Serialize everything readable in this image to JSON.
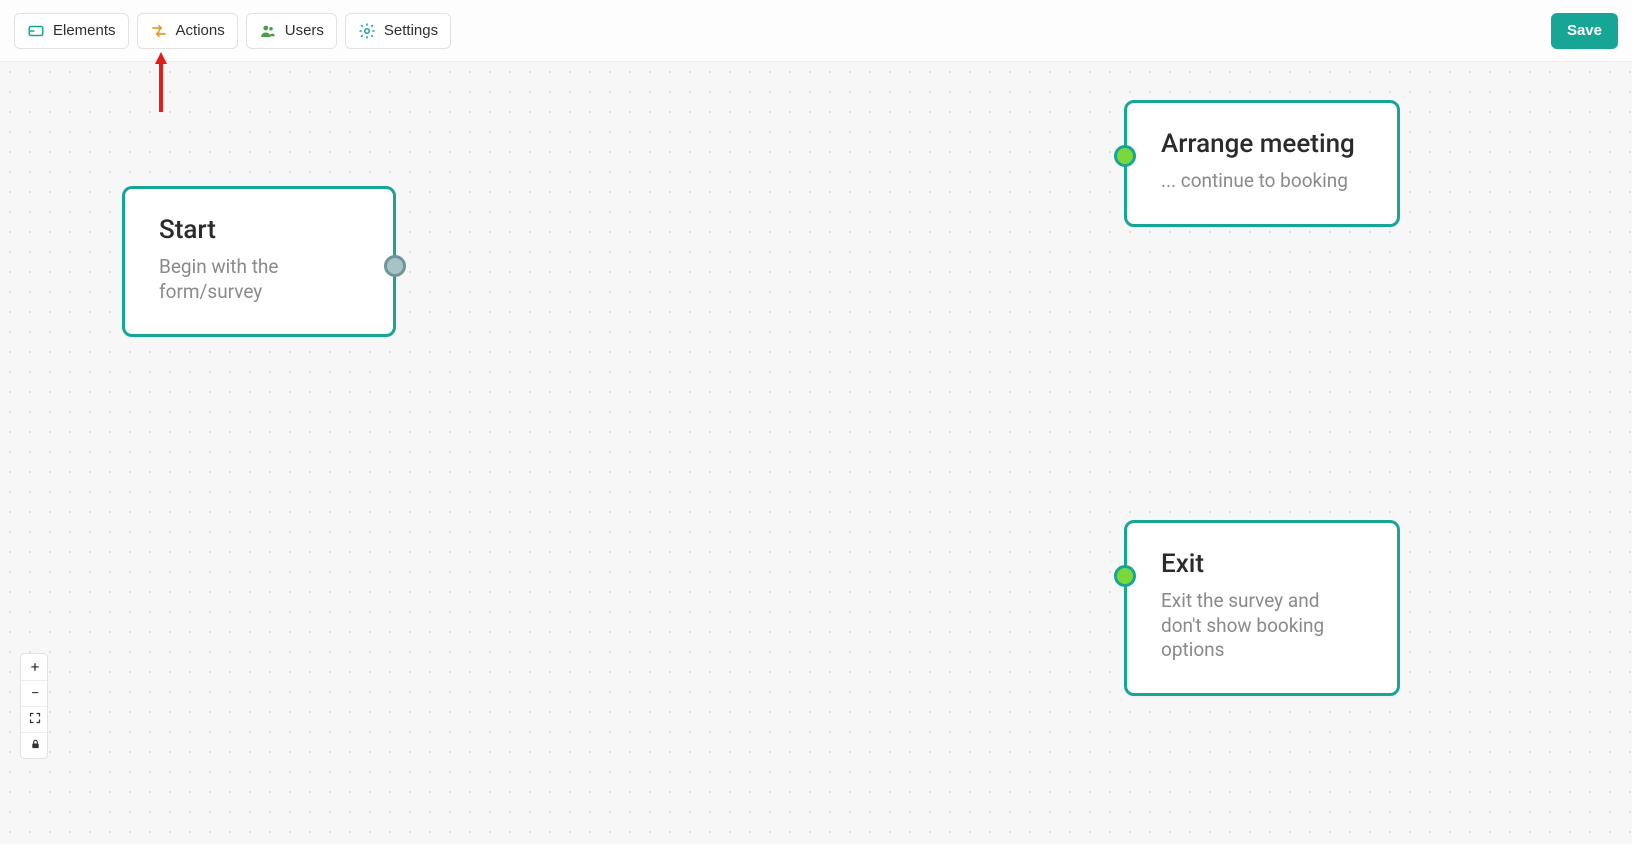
{
  "toolbar": {
    "elements": "Elements",
    "actions": "Actions",
    "users": "Users",
    "settings": "Settings",
    "save": "Save"
  },
  "nodes": {
    "start": {
      "title": "Start",
      "subtitle": "Begin with the form/survey"
    },
    "arrange": {
      "title": "Arrange meeting",
      "subtitle": "... continue to booking"
    },
    "exit": {
      "title": "Exit",
      "subtitle": "Exit the survey and don't show booking options"
    }
  },
  "colors": {
    "accent": "#17a695",
    "port_green": "#7bd83a",
    "annotation": "#e21b1b"
  }
}
